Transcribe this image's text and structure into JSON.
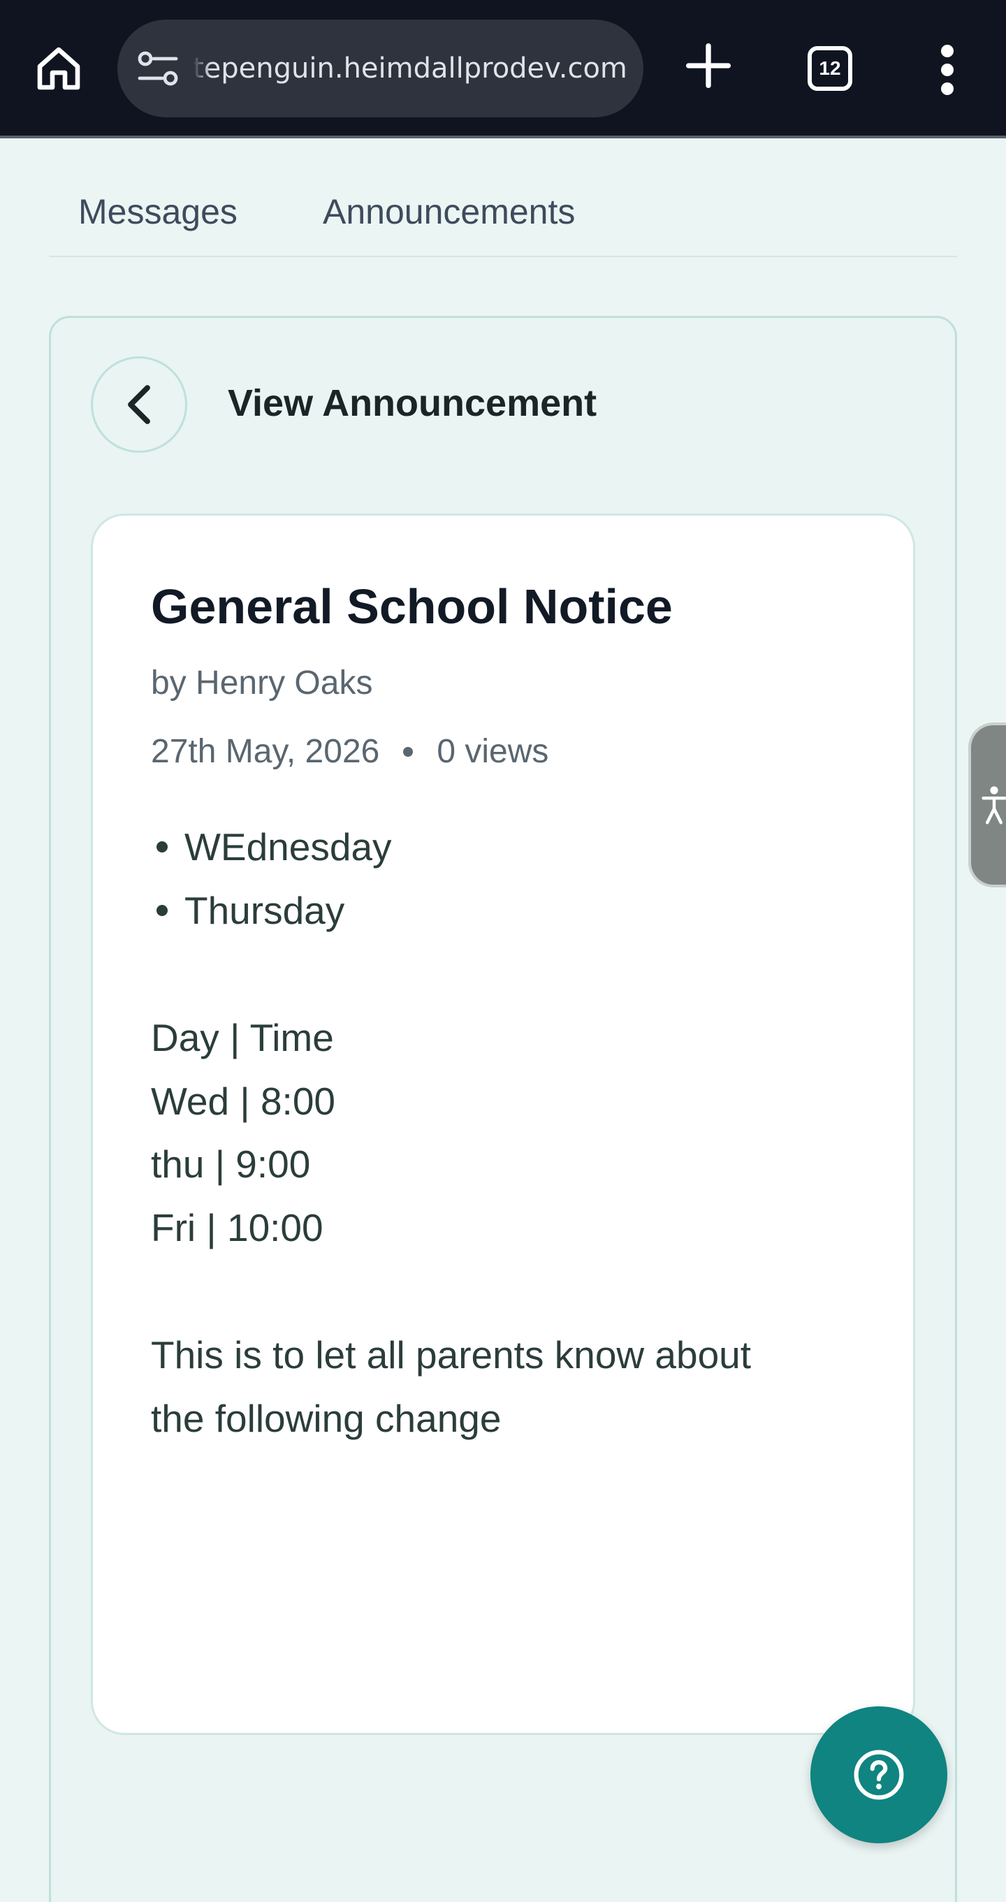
{
  "browser": {
    "url": "tepenguin.heimdallprodev.com",
    "tab_count": "12",
    "icons": [
      "home-icon",
      "site-settings-icon",
      "new-tab-plus-icon",
      "tab-switcher-icon",
      "overflow-menu-icon"
    ]
  },
  "nav": {
    "tabs": [
      {
        "label": "Messages"
      },
      {
        "label": "Announcements"
      }
    ]
  },
  "page": {
    "title": "View Announcement"
  },
  "announcement": {
    "title": "General School Notice",
    "author": "by Henry Oaks",
    "date": "27th May, 2026",
    "views": "0 views",
    "bullets": [
      "WEdnesday",
      "Thursday"
    ],
    "table_lines": [
      "Day | Time",
      "Wed | 8:00",
      "thu | 9:00",
      "Fri | 10:00"
    ],
    "paragraph_lines": [
      "This is to let all parents know about",
      "the following change"
    ]
  },
  "colors": {
    "accent": "#0f8480",
    "background": "#ebf5f4",
    "browser_bar": "#0f1420"
  }
}
